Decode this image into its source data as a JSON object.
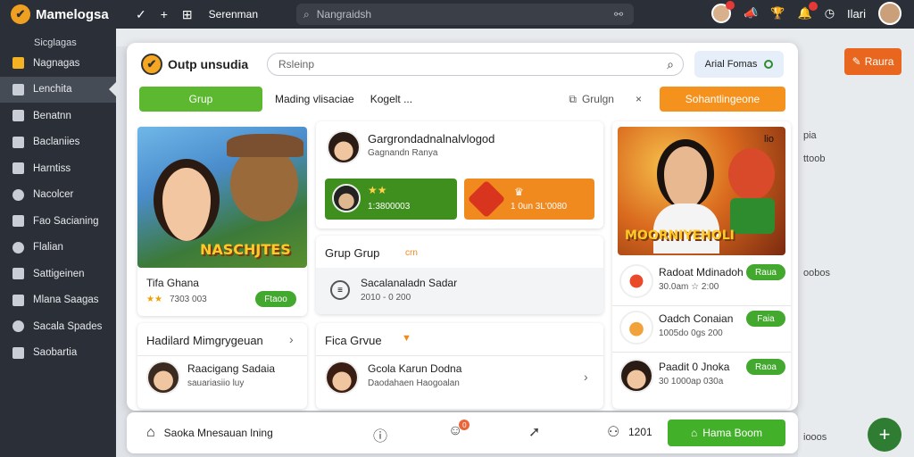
{
  "app": {
    "name": "Mamelogsa",
    "search_placeholder": "Nangraidsh",
    "top_label": "Serenman",
    "user_label": "Ilari"
  },
  "sidebar": {
    "heading": "Sicglagas",
    "items": [
      {
        "label": "Nagnagas"
      },
      {
        "label": "Lenchita"
      },
      {
        "label": "Benatnn"
      },
      {
        "label": "Baclaniies"
      },
      {
        "label": "Harntiss"
      },
      {
        "label": "Nacolcer"
      },
      {
        "label": "Fao Sacianing"
      },
      {
        "label": "Flalian"
      },
      {
        "label": "Sattigeinen"
      },
      {
        "label": "Mlana Saagas"
      },
      {
        "label": "Sacala Spades"
      },
      {
        "label": "Saobartia"
      }
    ],
    "active_index": 1
  },
  "background": {
    "orange_button": "Raura",
    "side_label_1": "pia",
    "side_label_2": "ttoob",
    "side_label_3": "oobos",
    "bottom_label": "iooos"
  },
  "panel": {
    "title": "Outp unsudia",
    "search_placeholder": "Rsleinp",
    "filter_label": "Arial Fomas",
    "green_tab": "Grup",
    "tab1": "Mading vlisaciae",
    "tab2": "Kogelt   ...",
    "sort_label": "Grulgn",
    "close_label": "×",
    "orange_tab": "Sohantlingeone"
  },
  "card_left_game": {
    "art_title": "NASCHJTES",
    "name": "Tifa Ghana",
    "rating": "7303 003",
    "button": "Ftaoo"
  },
  "card_left_list": {
    "title": "Hadilard Mimgrygeuan",
    "person_name": "Raacigang Sadaia",
    "person_sub": "sauariasiio luy"
  },
  "card_mid_top": {
    "title": "Gargrondadnalnalvlogod",
    "sub": "Gagnandn Ranya",
    "green_stats": "1:3800003",
    "orange_stats": "1 0un 3L'0080"
  },
  "card_mid_group": {
    "title": "Grup Grup",
    "tag": "crn",
    "item_name": "Sacalanaladn Sadar",
    "item_sub": "2010 - 0 200"
  },
  "card_mid_list": {
    "title": "Fica Grvue",
    "person_name": "Gcola Karun Dodna",
    "person_sub": "Daodahaen Haogoalan"
  },
  "card_right": {
    "art_title": "MOORNIYEHOLI",
    "corner_label": "lio",
    "rows": [
      {
        "name": "Radoat Mdinadoh",
        "sub": "30.0am ☆ 2:00",
        "button": "Raua"
      },
      {
        "name": "Oadch Conaian",
        "sub": "1005do 0gs 200",
        "button": "Faia"
      },
      {
        "name": "Paadit 0 Jnoka",
        "sub": "30 1000ap 030a",
        "button": "Raoa"
      }
    ]
  },
  "bottombar": {
    "label": "Saoka Mnesauan lning",
    "count": "1201",
    "button": "Hama Boom",
    "badge": "0"
  },
  "colors": {
    "green": "#5cb82e",
    "orange": "#f5921e",
    "dark": "#2b3038"
  }
}
